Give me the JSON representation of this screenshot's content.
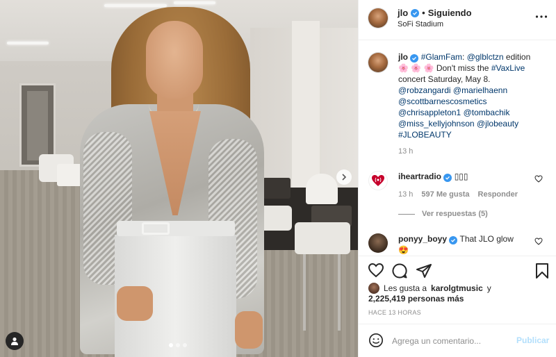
{
  "header": {
    "username": "jlo",
    "follow_status": "Siguiendo",
    "separator": "•",
    "location": "SoFi Stadium",
    "more_icon": "more-horizontal-icon"
  },
  "caption": {
    "username": "jlo",
    "parts": [
      {
        "text": "#GlamFam",
        "link": true
      },
      {
        "text": ": ",
        "link": false
      },
      {
        "text": "@glblctzn",
        "link": true
      },
      {
        "text": " edition",
        "link": false
      }
    ],
    "line2_emojis": "🌸 🌸 🌸",
    "line2_text": " Don't miss the ",
    "line2_link": "#VaxLive",
    "line3": "concert Saturday, May 8.",
    "mentions": [
      "@robzangardi @marielhaenn",
      "@scottbarnescosmetics",
      "@chrisappleton1 @tombachik",
      "@miss_kellyjohnson @jlobeauty",
      "#JLOBEAUTY"
    ],
    "time": "13 h"
  },
  "comments": [
    {
      "username": "iheartradio",
      "text": "▯▯▯",
      "time": "13 h",
      "likes": "597 Me gusta",
      "reply": "Responder",
      "view_replies": "Ver respuestas (5)"
    },
    {
      "username": "ponyy_boyy",
      "text": "That JLO glow",
      "emoji": "😍"
    }
  ],
  "likes": {
    "prefix": "Les gusta a",
    "user": "karolgtmusic",
    "suffix": "y",
    "count": "2,225,419 personas más"
  },
  "timestamp": "HACE 13 HORAS",
  "add_comment": {
    "placeholder": "Agrega un comentario...",
    "post_label": "Publicar"
  },
  "colors": {
    "verified": "#3897f0",
    "link": "#00376b",
    "muted": "#8e8e8e",
    "post_disabled": "#b2dffc",
    "iheart_red": "#c6002b"
  },
  "carousel": {
    "current": 1,
    "total": 3
  }
}
